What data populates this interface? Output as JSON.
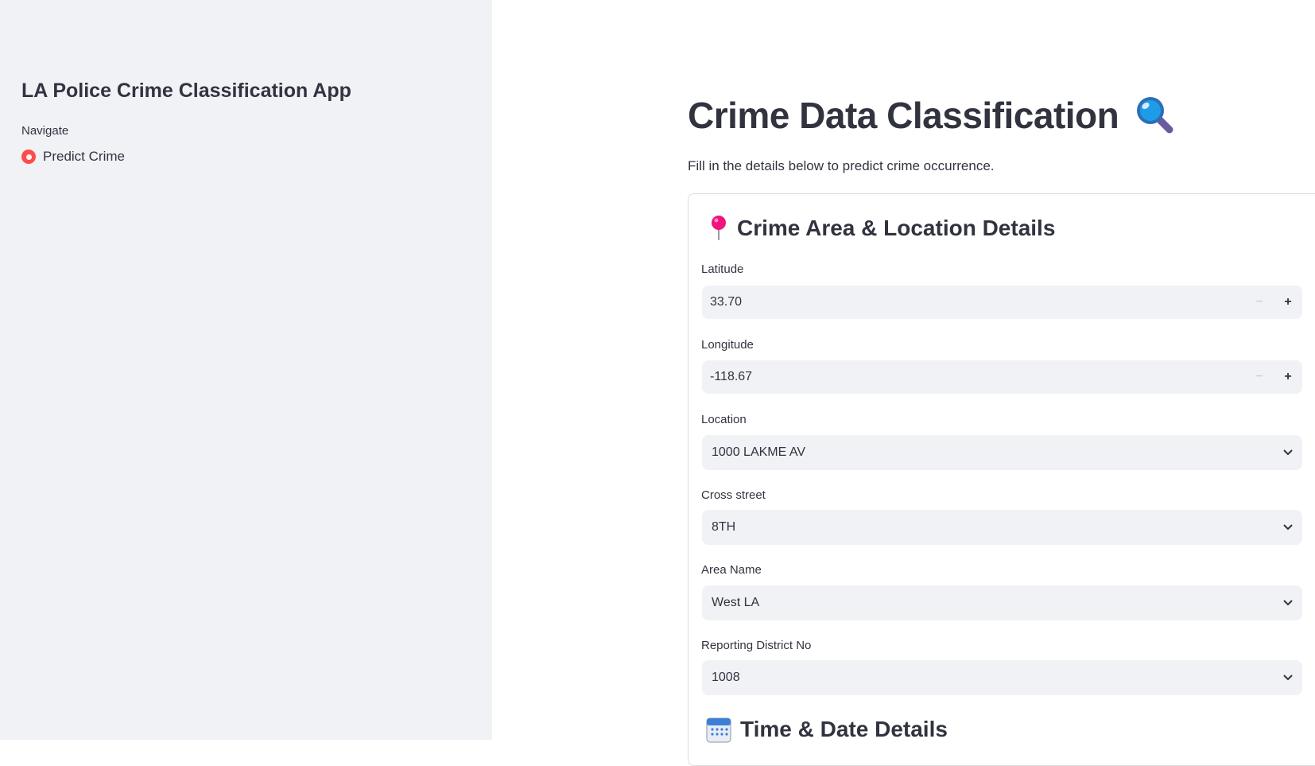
{
  "sidebar": {
    "title": "LA Police Crime Classification App",
    "nav_label": "Navigate",
    "nav_options": [
      {
        "label": "Predict Crime",
        "selected": true
      }
    ]
  },
  "main": {
    "title": "Crime Data Classification",
    "title_icon": "magnifying-glass-icon",
    "caption": "Fill in the details below to predict crime occurrence."
  },
  "sections": {
    "location": {
      "header": "Crime Area & Location Details",
      "icon": "round-pushpin-icon",
      "latitude": {
        "label": "Latitude",
        "value": "33.70"
      },
      "longitude": {
        "label": "Longitude",
        "value": "-118.67"
      },
      "location": {
        "label": "Location",
        "value": "1000 LAKME AV"
      },
      "cross_street": {
        "label": "Cross street",
        "value": "8TH"
      },
      "area_name": {
        "label": "Area Name",
        "value": "West LA"
      },
      "reporting_district": {
        "label": "Reporting District No",
        "value": "1008"
      }
    },
    "time": {
      "header": "Time & Date Details",
      "icon": "calendar-icon"
    }
  },
  "colors": {
    "sidebar_bg": "#f0f2f6",
    "accent": "#ff4b4b",
    "text": "#31333f",
    "input_bg": "#f0f2f6"
  }
}
